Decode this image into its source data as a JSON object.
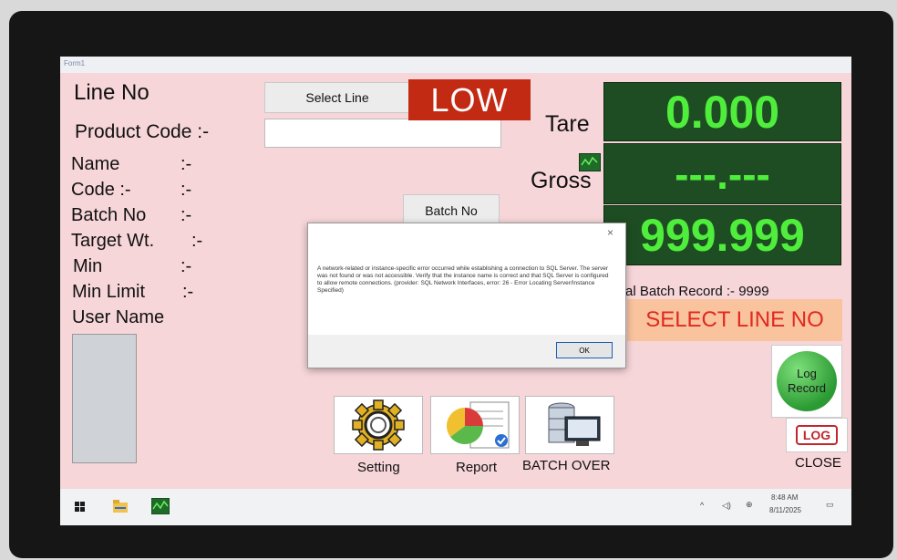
{
  "window": {
    "title": "Form1"
  },
  "labels": {
    "line_no": "Line No",
    "product_code": "Product Code :-",
    "name": "Name",
    "name_sep": ":-",
    "code": "Code :-",
    "code_sep": ":-",
    "batch_no": "Batch No",
    "batch_no_sep": ":-",
    "target_wt": "Target Wt.",
    "target_wt_sep": ":-",
    "min": "Min",
    "min_sep": ":-",
    "min_limit": "Min Limit",
    "min_limit_sep": ":-",
    "user_name": "User Name",
    "tare": "Tare",
    "gross": "Gross",
    "batch_record": "al Batch Record :- 9999"
  },
  "buttons": {
    "select_line": "Select Line",
    "batch_no": "Batch No",
    "setting": "Setting",
    "report": "Report",
    "batch_over": "BATCH OVER",
    "log_record": "Log Record",
    "log_icon_text": "LOG",
    "close": "CLOSE"
  },
  "inputs": {
    "product_code_value": ""
  },
  "status": {
    "low": "LOW",
    "select_line_no": "SELECT LINE NO"
  },
  "displays": {
    "tare_value": "0.000",
    "gross_value": "---.---",
    "third_value": "999.999"
  },
  "dialog": {
    "message": "A network-related or instance-specific error occurred while establishing a connection to SQL Server. The server was not found or was not accessible. Verify that the instance name is correct and that SQL Server is configured to allow remote connections. (provider: SQL Network Interfaces, error: 26 - Error Locating Server/Instance Specified)",
    "ok": "OK",
    "close_glyph": "×"
  },
  "taskbar": {
    "time": "8:48 AM",
    "date": "8/11/2025"
  },
  "colors": {
    "background": "#f7d6d9",
    "display_bg": "#1f4d23",
    "display_text": "#4fee3c",
    "low_bg": "#c22a14",
    "select_line_bg": "#f9c39d",
    "select_line_text": "#e02a20"
  }
}
